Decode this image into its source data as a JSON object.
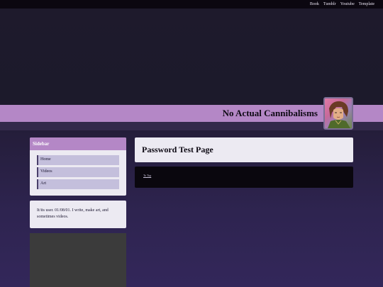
{
  "topnav": {
    "items": [
      {
        "label": "Book"
      },
      {
        "label": "Tumblr"
      },
      {
        "label": "Youtube"
      },
      {
        "label": "Template"
      }
    ]
  },
  "header": {
    "title": "No Actual Cannibalisms",
    "avatar_icon": "character-portrait"
  },
  "sidebar": {
    "heading": "Sidebar",
    "items": [
      {
        "label": "Home"
      },
      {
        "label": "Videos"
      },
      {
        "label": "Art"
      }
    ],
    "bio": "It/its user. 01/08/01. I write, make art, and sometimes videos."
  },
  "main": {
    "page_title": "Password Test Page",
    "to_top_link": "To Top"
  },
  "colors": {
    "accent": "#b487c6",
    "panel": "#eceaf2",
    "nav_item": "#c4bfdc",
    "dark": "#0a070e"
  }
}
